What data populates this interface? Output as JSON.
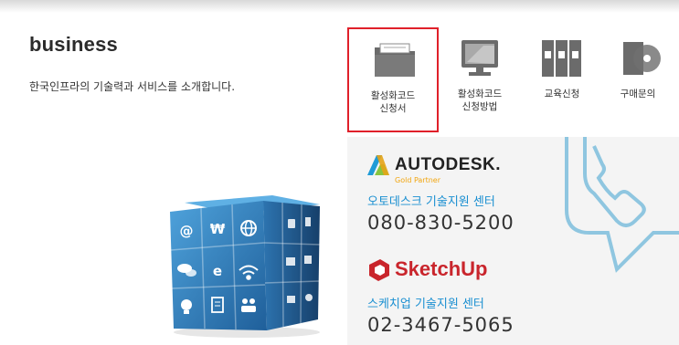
{
  "section": {
    "title": "business",
    "description": "한국인프라의 기술력과 서비스를 소개합니다."
  },
  "menu": [
    {
      "line1": "활성화코드",
      "line2": "신청서",
      "icon": "folder-icon",
      "active": true
    },
    {
      "line1": "활성화코드",
      "line2": "신청방법",
      "icon": "monitor-icon",
      "active": false
    },
    {
      "line1": "교육신청",
      "line2": "",
      "icon": "binders-icon",
      "active": false
    },
    {
      "line1": "구매문의",
      "line2": "",
      "icon": "box-disc-icon",
      "active": false
    }
  ],
  "support": {
    "autodesk": {
      "brand": "AUTODESK.",
      "tier": "Gold Partner",
      "center": "오토데스크 기술지원 센터",
      "phone": "080-830-5200"
    },
    "sketchup": {
      "brand": "SketchUp",
      "center": "스케치업 기술지원 센터",
      "phone": "02-3467-5065"
    }
  },
  "colors": {
    "accent_blue": "#1a8fd1",
    "highlight_red": "#e0202a",
    "sketchup_red": "#c9252c",
    "autodesk_orange": "#f2a60f"
  },
  "cube_icons": [
    "at-icon",
    "won-icon",
    "globe-icon",
    "chat-icon",
    "ie-icon",
    "wifi-icon",
    "bulb-icon",
    "document-icon",
    "users-icon"
  ]
}
